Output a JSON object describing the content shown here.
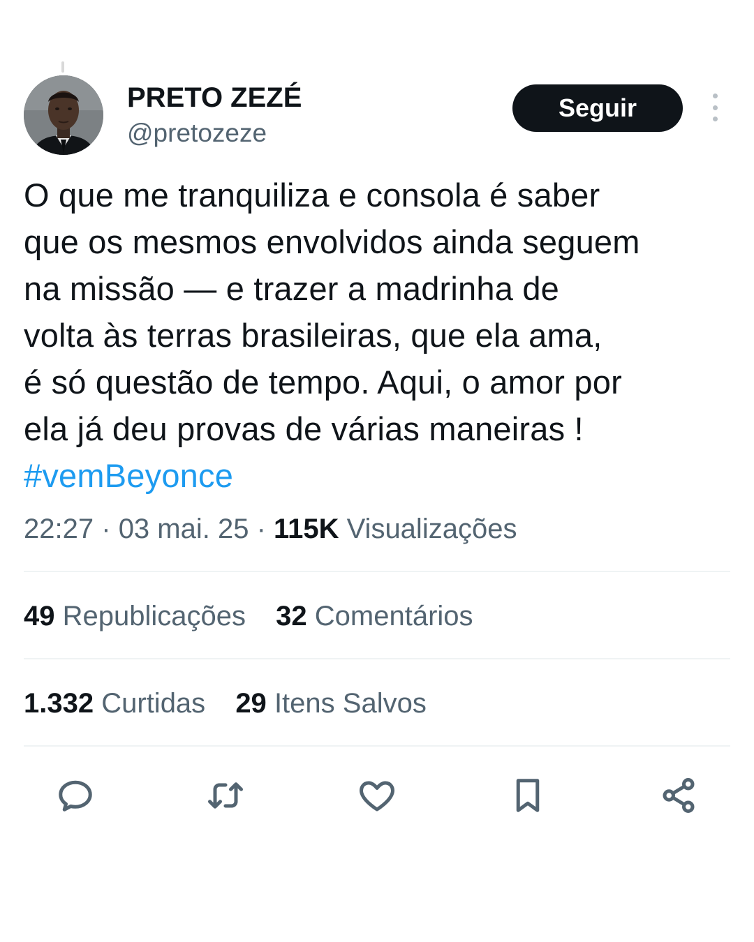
{
  "author": {
    "name": "PRETO ZEZÉ",
    "handle": "@pretozeze"
  },
  "follow_label": "Seguir",
  "tweet": {
    "lines": [
      "O que me tranquiliza e consola é saber",
      "que os mesmos envolvidos ainda seguem",
      "na missão — e trazer a madrinha de",
      "volta às terras brasileiras, que ela ama,",
      "é só questão de tempo. Aqui, o amor por",
      "ela já deu provas de várias maneiras !"
    ],
    "hashtag": "#vemBeyonce"
  },
  "meta": {
    "time": "22:27",
    "separator": "·",
    "date": "03 mai. 25",
    "views_count": "115K",
    "views_label": "Visualizações"
  },
  "stats": {
    "reposts_count": "49",
    "reposts_label": "Republicações",
    "comments_count": "32",
    "comments_label": "Comentários",
    "likes_count": "1.332",
    "likes_label": "Curtidas",
    "saves_count": "29",
    "saves_label": "Itens Salvos"
  },
  "actions": [
    {
      "icon": "reply-icon"
    },
    {
      "icon": "retweet-icon"
    },
    {
      "icon": "heart-icon"
    },
    {
      "icon": "bookmark-icon"
    },
    {
      "icon": "share-icon"
    }
  ],
  "colors": {
    "text": "#0f1419",
    "secondary": "#536471",
    "accent": "#1d9bf0",
    "divider": "#eff3f4"
  }
}
